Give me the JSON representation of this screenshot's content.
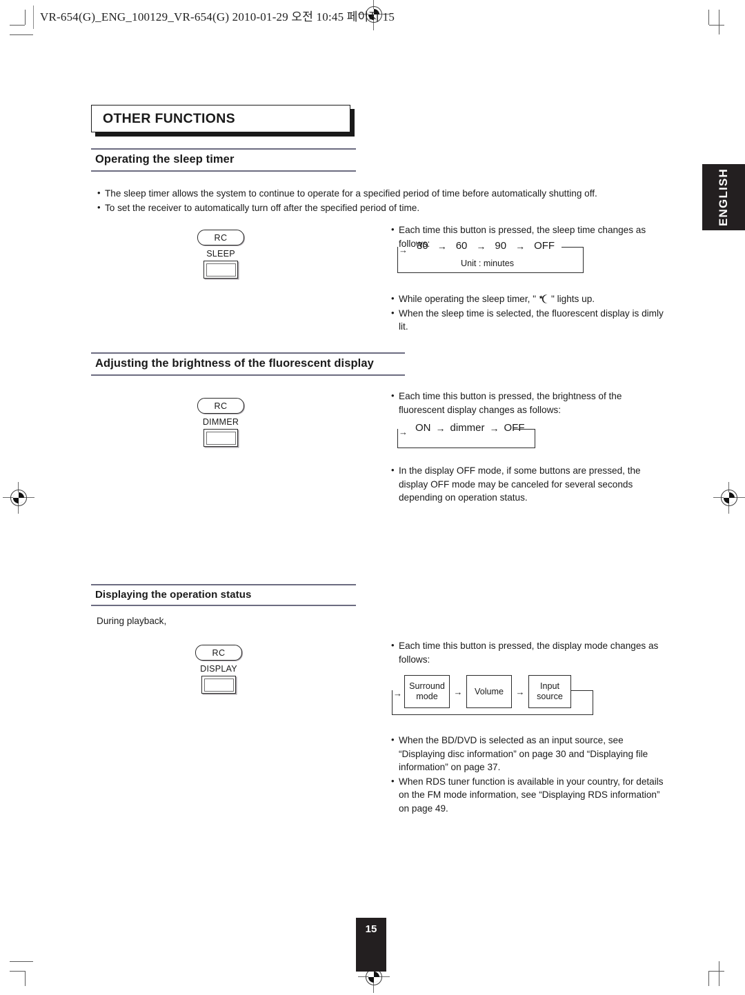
{
  "print_header": "VR-654(G)_ENG_100129_VR-654(G)  2010-01-29  오전 10:45  페이지 15",
  "chapter_title": "OTHER FUNCTIONS",
  "side_tab": "ENGLISH",
  "page_number": "15",
  "sections": [
    {
      "heading": "Operating the sleep timer",
      "intro_bullets": [
        "The sleep timer allows the system to continue to operate for a specified period of time before automatically shutting off.",
        "To set the receiver to automatically turn off after the specified period of time."
      ],
      "button": {
        "rc_label": "RC",
        "key_label": "SLEEP"
      },
      "right_bullets": [
        "Each time this button is pressed, the sleep time changes as follows:"
      ],
      "cycle": {
        "steps": [
          "30",
          "60",
          "90",
          "OFF"
        ],
        "arrow": "→",
        "lead_arrow": "→",
        "note": "Unit : minutes"
      },
      "after_bullets": [
        {
          "pre": "While operating the sleep timer, \"",
          "icon": "moon-star-icon",
          "post": "\" lights up."
        },
        {
          "pre": "When the sleep time is selected, the fluorescent display is dimly lit."
        }
      ]
    },
    {
      "heading": "Adjusting the brightness of the fluorescent display",
      "button": {
        "rc_label": "RC",
        "key_label": "DIMMER"
      },
      "right_bullets": [
        "Each time this button is pressed, the brightness of the fluorescent display changes as follows:"
      ],
      "cycle": {
        "steps": [
          "ON",
          "dimmer",
          "OFF"
        ],
        "arrow": "→",
        "lead_arrow": "→"
      },
      "after_bullets": [
        {
          "pre": "In the display OFF mode, if some buttons are pressed, the display OFF mode may be canceled for several seconds depending on operation status."
        }
      ]
    },
    {
      "heading": "Displaying the operation status",
      "lead_text": "During playback,",
      "button": {
        "rc_label": "RC",
        "key_label": "DISPLAY"
      },
      "right_bullets": [
        "Each time this button is pressed, the display mode changes as follows:"
      ],
      "box_cycle": {
        "boxes": [
          "Surround mode",
          "Volume",
          "Input source"
        ],
        "arrow": "→",
        "lead_arrow": "→"
      },
      "after_bullets": [
        {
          "pre": "When the BD/DVD is selected as an input source, see “Displaying disc information” on page 30 and “Displaying file information” on page 37."
        },
        {
          "pre": "When RDS tuner function is available in your country, for details on the FM mode information, see “Displaying RDS information” on page 49."
        }
      ]
    }
  ],
  "colors": {
    "rule": "#6b6b80",
    "ink": "#1a1a1a",
    "tab_bg": "#231f20"
  }
}
